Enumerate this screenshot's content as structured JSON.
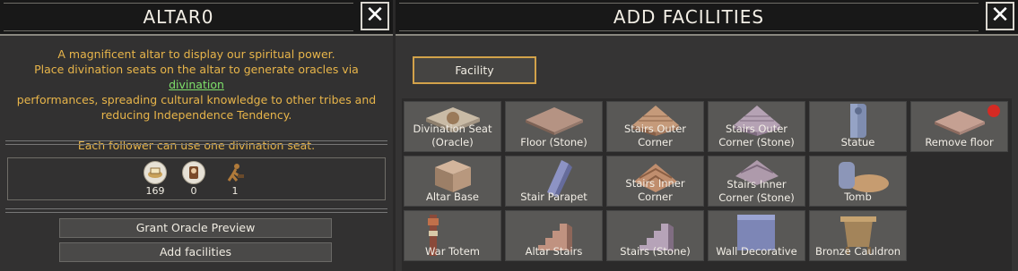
{
  "left_panel": {
    "title": "ALTAR0",
    "close": "✕",
    "description": {
      "line1": "A magnificent altar to display our spiritual power.",
      "line2_before": "Place divination seats on the altar to generate oracles via ",
      "line2_link": "divination",
      "line3": "performances, spreading cultural knowledge to other tribes and",
      "line4": "reducing Independence Tendency.",
      "line5": "Each follower can use one divination seat."
    },
    "stats": [
      {
        "icon": "food-icon",
        "value": "169"
      },
      {
        "icon": "follower-icon",
        "value": "0"
      },
      {
        "icon": "worker-icon",
        "value": "1"
      }
    ],
    "buttons": {
      "grant_oracle_preview": "Grant Oracle Preview",
      "add_facilities": "Add facilities"
    }
  },
  "right_panel": {
    "title": "ADD FACILITIES",
    "close": "✕",
    "filter_button": "Facility",
    "tiles": [
      {
        "label": "Divination Seat (Oracle)",
        "icon": "divination-seat-icon"
      },
      {
        "label": "Floor (Stone)",
        "icon": "floor-stone-icon"
      },
      {
        "label": "Stairs Outer Corner",
        "icon": "stairs-outer-corner-icon"
      },
      {
        "label": "Stairs Outer Corner (Stone)",
        "icon": "stairs-outer-corner-stone-icon"
      },
      {
        "label": "Statue",
        "icon": "statue-icon"
      },
      {
        "label": "Remove floor",
        "icon": "remove-floor-icon"
      },
      {
        "label": "Altar Base",
        "icon": "altar-base-icon"
      },
      {
        "label": "Stair Parapet",
        "icon": "stair-parapet-icon"
      },
      {
        "label": "Stairs Inner Corner",
        "icon": "stairs-inner-corner-icon"
      },
      {
        "label": "Stairs Inner Corner (Stone)",
        "icon": "stairs-inner-corner-stone-icon"
      },
      {
        "label": "Tomb",
        "icon": "tomb-icon"
      },
      {
        "label": "War Totem",
        "icon": "war-totem-icon"
      },
      {
        "label": "Altar Stairs",
        "icon": "altar-stairs-icon"
      },
      {
        "label": "Stairs (Stone)",
        "icon": "stairs-stone-icon"
      },
      {
        "label": "Wall Decorative",
        "icon": "wall-decorative-icon"
      },
      {
        "label": "Bronze Cauldron",
        "icon": "bronze-cauldron-icon"
      }
    ]
  }
}
